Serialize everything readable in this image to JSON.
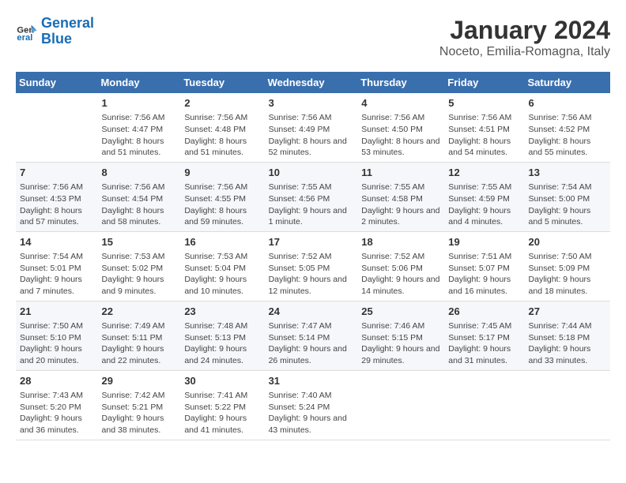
{
  "logo": {
    "text_general": "General",
    "text_blue": "Blue"
  },
  "title": "January 2024",
  "subtitle": "Noceto, Emilia-Romagna, Italy",
  "headers": [
    "Sunday",
    "Monday",
    "Tuesday",
    "Wednesday",
    "Thursday",
    "Friday",
    "Saturday"
  ],
  "weeks": [
    [
      {
        "day": "",
        "sunrise": "",
        "sunset": "",
        "daylight": ""
      },
      {
        "day": "1",
        "sunrise": "Sunrise: 7:56 AM",
        "sunset": "Sunset: 4:47 PM",
        "daylight": "Daylight: 8 hours and 51 minutes."
      },
      {
        "day": "2",
        "sunrise": "Sunrise: 7:56 AM",
        "sunset": "Sunset: 4:48 PM",
        "daylight": "Daylight: 8 hours and 51 minutes."
      },
      {
        "day": "3",
        "sunrise": "Sunrise: 7:56 AM",
        "sunset": "Sunset: 4:49 PM",
        "daylight": "Daylight: 8 hours and 52 minutes."
      },
      {
        "day": "4",
        "sunrise": "Sunrise: 7:56 AM",
        "sunset": "Sunset: 4:50 PM",
        "daylight": "Daylight: 8 hours and 53 minutes."
      },
      {
        "day": "5",
        "sunrise": "Sunrise: 7:56 AM",
        "sunset": "Sunset: 4:51 PM",
        "daylight": "Daylight: 8 hours and 54 minutes."
      },
      {
        "day": "6",
        "sunrise": "Sunrise: 7:56 AM",
        "sunset": "Sunset: 4:52 PM",
        "daylight": "Daylight: 8 hours and 55 minutes."
      }
    ],
    [
      {
        "day": "7",
        "sunrise": "Sunrise: 7:56 AM",
        "sunset": "Sunset: 4:53 PM",
        "daylight": "Daylight: 8 hours and 57 minutes."
      },
      {
        "day": "8",
        "sunrise": "Sunrise: 7:56 AM",
        "sunset": "Sunset: 4:54 PM",
        "daylight": "Daylight: 8 hours and 58 minutes."
      },
      {
        "day": "9",
        "sunrise": "Sunrise: 7:56 AM",
        "sunset": "Sunset: 4:55 PM",
        "daylight": "Daylight: 8 hours and 59 minutes."
      },
      {
        "day": "10",
        "sunrise": "Sunrise: 7:55 AM",
        "sunset": "Sunset: 4:56 PM",
        "daylight": "Daylight: 9 hours and 1 minute."
      },
      {
        "day": "11",
        "sunrise": "Sunrise: 7:55 AM",
        "sunset": "Sunset: 4:58 PM",
        "daylight": "Daylight: 9 hours and 2 minutes."
      },
      {
        "day": "12",
        "sunrise": "Sunrise: 7:55 AM",
        "sunset": "Sunset: 4:59 PM",
        "daylight": "Daylight: 9 hours and 4 minutes."
      },
      {
        "day": "13",
        "sunrise": "Sunrise: 7:54 AM",
        "sunset": "Sunset: 5:00 PM",
        "daylight": "Daylight: 9 hours and 5 minutes."
      }
    ],
    [
      {
        "day": "14",
        "sunrise": "Sunrise: 7:54 AM",
        "sunset": "Sunset: 5:01 PM",
        "daylight": "Daylight: 9 hours and 7 minutes."
      },
      {
        "day": "15",
        "sunrise": "Sunrise: 7:53 AM",
        "sunset": "Sunset: 5:02 PM",
        "daylight": "Daylight: 9 hours and 9 minutes."
      },
      {
        "day": "16",
        "sunrise": "Sunrise: 7:53 AM",
        "sunset": "Sunset: 5:04 PM",
        "daylight": "Daylight: 9 hours and 10 minutes."
      },
      {
        "day": "17",
        "sunrise": "Sunrise: 7:52 AM",
        "sunset": "Sunset: 5:05 PM",
        "daylight": "Daylight: 9 hours and 12 minutes."
      },
      {
        "day": "18",
        "sunrise": "Sunrise: 7:52 AM",
        "sunset": "Sunset: 5:06 PM",
        "daylight": "Daylight: 9 hours and 14 minutes."
      },
      {
        "day": "19",
        "sunrise": "Sunrise: 7:51 AM",
        "sunset": "Sunset: 5:07 PM",
        "daylight": "Daylight: 9 hours and 16 minutes."
      },
      {
        "day": "20",
        "sunrise": "Sunrise: 7:50 AM",
        "sunset": "Sunset: 5:09 PM",
        "daylight": "Daylight: 9 hours and 18 minutes."
      }
    ],
    [
      {
        "day": "21",
        "sunrise": "Sunrise: 7:50 AM",
        "sunset": "Sunset: 5:10 PM",
        "daylight": "Daylight: 9 hours and 20 minutes."
      },
      {
        "day": "22",
        "sunrise": "Sunrise: 7:49 AM",
        "sunset": "Sunset: 5:11 PM",
        "daylight": "Daylight: 9 hours and 22 minutes."
      },
      {
        "day": "23",
        "sunrise": "Sunrise: 7:48 AM",
        "sunset": "Sunset: 5:13 PM",
        "daylight": "Daylight: 9 hours and 24 minutes."
      },
      {
        "day": "24",
        "sunrise": "Sunrise: 7:47 AM",
        "sunset": "Sunset: 5:14 PM",
        "daylight": "Daylight: 9 hours and 26 minutes."
      },
      {
        "day": "25",
        "sunrise": "Sunrise: 7:46 AM",
        "sunset": "Sunset: 5:15 PM",
        "daylight": "Daylight: 9 hours and 29 minutes."
      },
      {
        "day": "26",
        "sunrise": "Sunrise: 7:45 AM",
        "sunset": "Sunset: 5:17 PM",
        "daylight": "Daylight: 9 hours and 31 minutes."
      },
      {
        "day": "27",
        "sunrise": "Sunrise: 7:44 AM",
        "sunset": "Sunset: 5:18 PM",
        "daylight": "Daylight: 9 hours and 33 minutes."
      }
    ],
    [
      {
        "day": "28",
        "sunrise": "Sunrise: 7:43 AM",
        "sunset": "Sunset: 5:20 PM",
        "daylight": "Daylight: 9 hours and 36 minutes."
      },
      {
        "day": "29",
        "sunrise": "Sunrise: 7:42 AM",
        "sunset": "Sunset: 5:21 PM",
        "daylight": "Daylight: 9 hours and 38 minutes."
      },
      {
        "day": "30",
        "sunrise": "Sunrise: 7:41 AM",
        "sunset": "Sunset: 5:22 PM",
        "daylight": "Daylight: 9 hours and 41 minutes."
      },
      {
        "day": "31",
        "sunrise": "Sunrise: 7:40 AM",
        "sunset": "Sunset: 5:24 PM",
        "daylight": "Daylight: 9 hours and 43 minutes."
      },
      {
        "day": "",
        "sunrise": "",
        "sunset": "",
        "daylight": ""
      },
      {
        "day": "",
        "sunrise": "",
        "sunset": "",
        "daylight": ""
      },
      {
        "day": "",
        "sunrise": "",
        "sunset": "",
        "daylight": ""
      }
    ]
  ]
}
